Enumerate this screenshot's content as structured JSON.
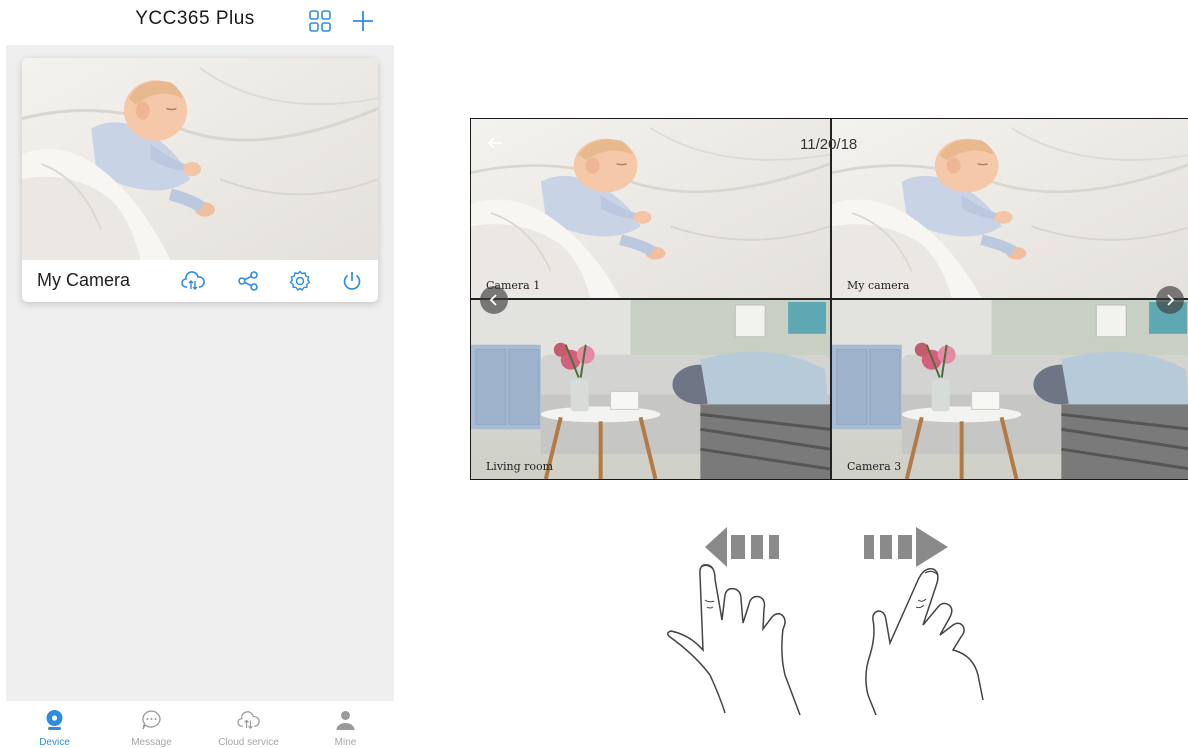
{
  "header": {
    "title": "YCC365 Plus",
    "grid_icon": "grid-view-icon",
    "add_icon": "plus-icon"
  },
  "device_card": {
    "name": "My Camera",
    "actions": [
      "cloud-sync-icon",
      "share-icon",
      "settings-icon",
      "power-icon"
    ],
    "accent_color": "#2e8de0"
  },
  "bottom_nav": {
    "items": [
      {
        "label": "Device",
        "icon": "camera-icon",
        "active": true
      },
      {
        "label": "Message",
        "icon": "chat-bubble-icon",
        "active": false
      },
      {
        "label": "Cloud service",
        "icon": "cloud-sync-icon",
        "active": false
      },
      {
        "label": "Mine",
        "icon": "person-icon",
        "active": false
      }
    ]
  },
  "multiview": {
    "date": "11/20/18",
    "tiles": [
      {
        "label": "Camera 1"
      },
      {
        "label": "My camera"
      },
      {
        "label": "Living room"
      },
      {
        "label": "Camera 3"
      }
    ]
  },
  "gestures": {
    "swipe_left_icon": "swipe-left-hand-icon",
    "swipe_right_icon": "swipe-right-hand-icon"
  }
}
